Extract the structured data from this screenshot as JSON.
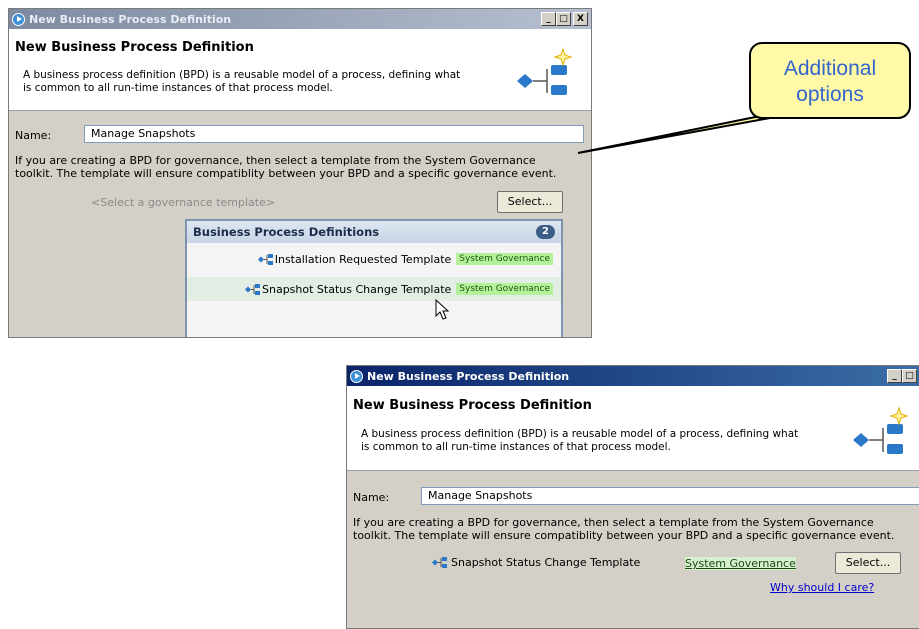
{
  "dialog_top": {
    "window_title": "New Business Process Definition",
    "header_title": "New Business Process Definition",
    "description_line1": "A business process definition (BPD) is a reusable model of a process, defining what",
    "description_line2": "is common to all run-time instances of that process model.",
    "name_label": "Name:",
    "name_value": "Manage Snapshots",
    "info_line1": "If you are creating a BPD for governance, then select a template from the System Governance",
    "info_line2": "toolkit. The template will ensure compatiblity between your BPD and a specific governance event.",
    "template_placeholder": "<Select a governance template>",
    "select_button": "Select...",
    "popup": {
      "title": "Business Process Definitions",
      "count": "2",
      "items": [
        {
          "label": "Installation Requested Template",
          "tag": "System Governance"
        },
        {
          "label": "Snapshot Status Change Template",
          "tag": "System Governance"
        }
      ]
    }
  },
  "dialog_bottom": {
    "window_title": "New Business Process Definition",
    "header_title": "New Business Process Definition",
    "description_line1": "A business process definition (BPD) is a reusable model of a process, defining what",
    "description_line2": "is common to all run-time instances of that process model.",
    "name_label": "Name:",
    "name_value": "Manage Snapshots",
    "info_line1": "If you are creating a BPD for governance, then select a template from the System Governance",
    "info_line2": "toolkit. The template will ensure compatiblity between your BPD and a specific governance event.",
    "selected_template": "Snapshot Status Change Template",
    "toolkit_link": "System Governance",
    "select_button": "Select...",
    "why_link": "Why should I care?"
  },
  "callout": {
    "line1": "Additional",
    "line2": "options"
  },
  "window_buttons": {
    "minimize": "_",
    "maximize": "□",
    "close": "X"
  },
  "icons": [
    "play-icon",
    "bpd-diagram-icon",
    "bpd-template-icon",
    "mouse-cursor-icon"
  ],
  "colors": {
    "accent_blue": "#3d8fd6",
    "tag_green": "#b6f09a",
    "callout_fill": "#fff9a8",
    "callout_text": "#3366cc"
  }
}
